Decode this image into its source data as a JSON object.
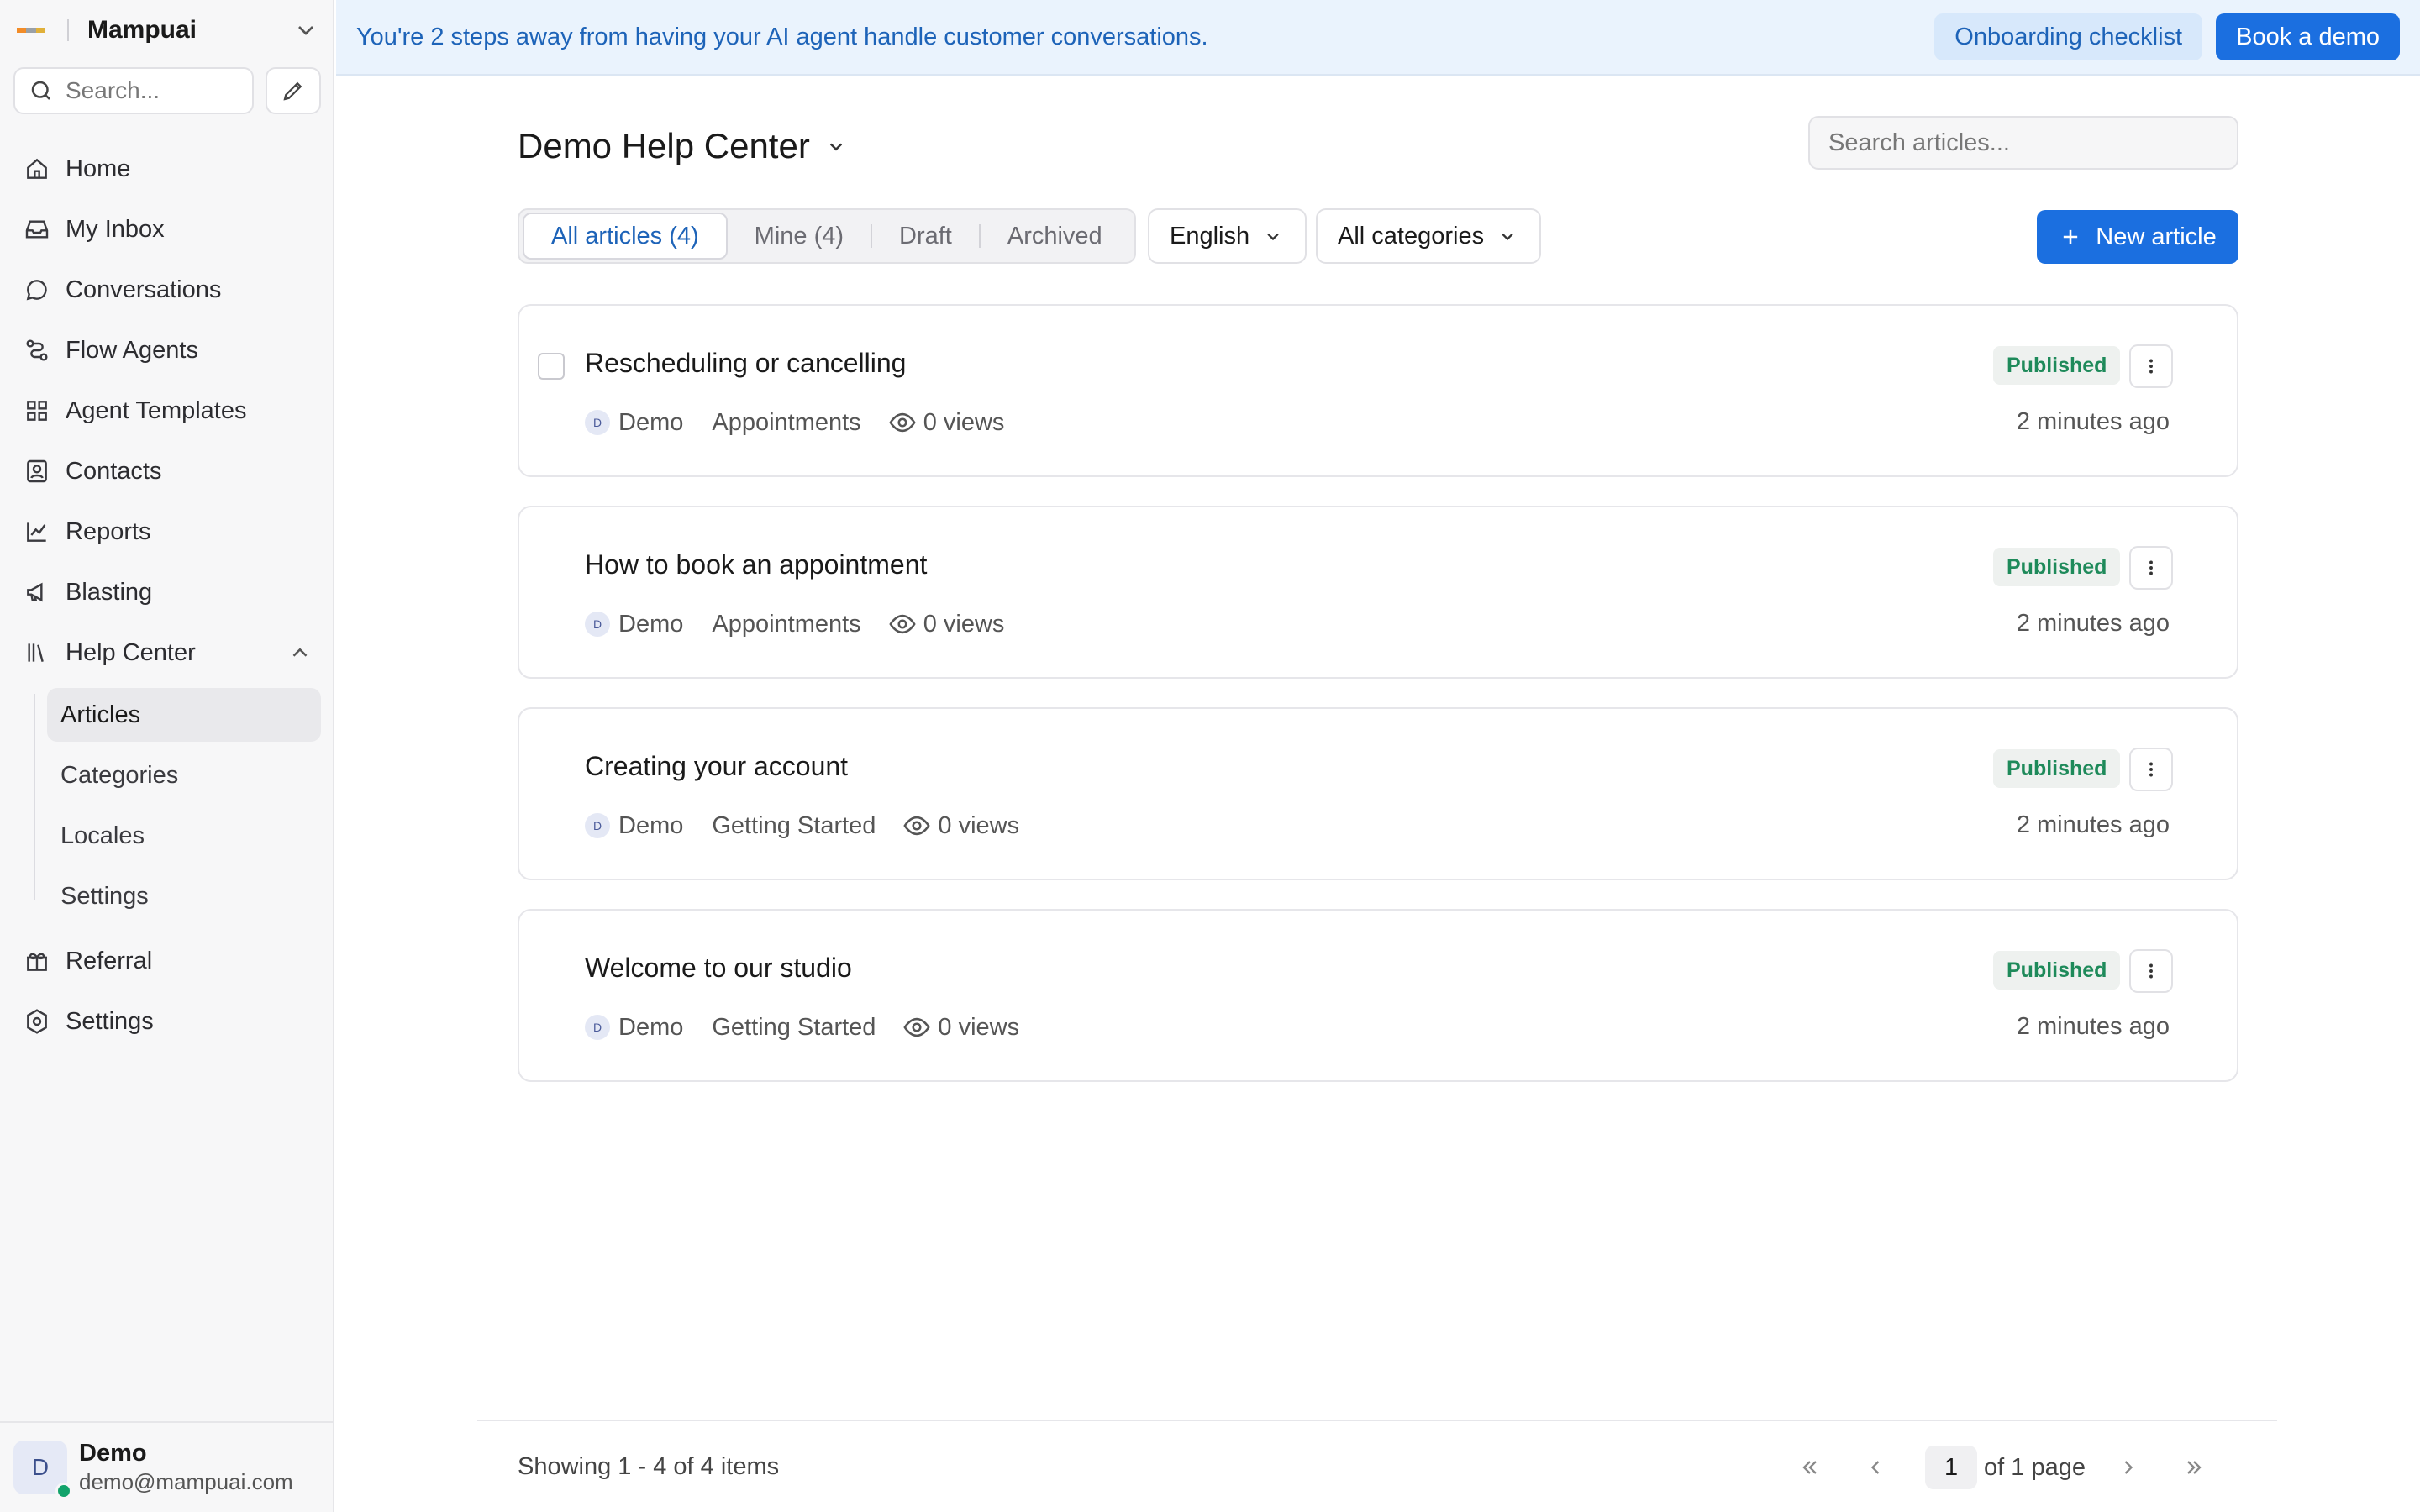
{
  "sidebar": {
    "brand": "Mampuai",
    "search_placeholder": "Search...",
    "nav": [
      {
        "label": "Home"
      },
      {
        "label": "My Inbox"
      },
      {
        "label": "Conversations"
      },
      {
        "label": "Flow Agents"
      },
      {
        "label": "Agent Templates"
      },
      {
        "label": "Contacts"
      },
      {
        "label": "Reports"
      },
      {
        "label": "Blasting"
      },
      {
        "label": "Help Center"
      }
    ],
    "help_center_sub": [
      {
        "label": "Articles",
        "active": true
      },
      {
        "label": "Categories"
      },
      {
        "label": "Locales"
      },
      {
        "label": "Settings"
      }
    ],
    "nav_bottom": [
      {
        "label": "Referral"
      },
      {
        "label": "Settings"
      }
    ],
    "user": {
      "initial": "D",
      "name": "Demo",
      "email": "demo@mampuai.com"
    }
  },
  "banner": {
    "text": "You're 2 steps away from having your AI agent handle customer conversations.",
    "checklist_label": "Onboarding checklist",
    "demo_label": "Book a demo"
  },
  "main": {
    "title": "Demo Help Center",
    "search_placeholder": "Search articles...",
    "tabs": [
      {
        "label": "All articles (4)",
        "active": true
      },
      {
        "label": "Mine (4)"
      },
      {
        "label": "Draft"
      },
      {
        "label": "Archived"
      }
    ],
    "language": "English",
    "category_filter": "All categories",
    "new_article_label": "New article"
  },
  "articles": [
    {
      "title": "Rescheduling or cancelling",
      "author_initial": "D",
      "author": "Demo",
      "category": "Appointments",
      "views": "0 views",
      "status": "Published",
      "updated": "2 minutes ago"
    },
    {
      "title": "How to book an appointment",
      "author_initial": "D",
      "author": "Demo",
      "category": "Appointments",
      "views": "0 views",
      "status": "Published",
      "updated": "2 minutes ago"
    },
    {
      "title": "Creating your account",
      "author_initial": "D",
      "author": "Demo",
      "category": "Getting Started",
      "views": "0 views",
      "status": "Published",
      "updated": "2 minutes ago"
    },
    {
      "title": "Welcome to our studio",
      "author_initial": "D",
      "author": "Demo",
      "category": "Getting Started",
      "views": "0 views",
      "status": "Published",
      "updated": "2 minutes ago"
    }
  ],
  "footer": {
    "showing": "Showing 1 - 4 of 4 items",
    "current_page": "1",
    "of_pages": "of 1 page"
  },
  "colors": {
    "accent": "#1b6fe0",
    "banner_bg": "#eaf3fd",
    "published": "#1e8a5a"
  },
  "icons": {
    "nav": [
      "home-icon",
      "inbox-icon",
      "chat-bubble-icon",
      "flow-icon",
      "grid-icon",
      "contact-card-icon",
      "chart-line-icon",
      "megaphone-icon",
      "library-icon"
    ],
    "nav_bottom": [
      "gift-icon",
      "settings-icon"
    ]
  }
}
